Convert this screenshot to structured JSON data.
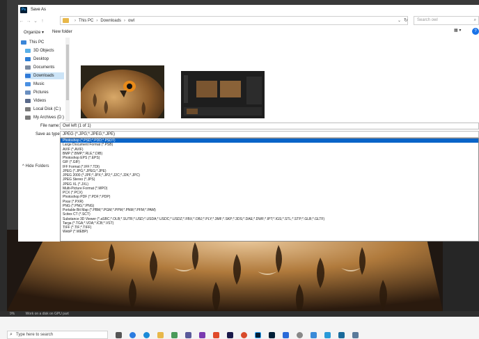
{
  "dialog": {
    "title": "Save As",
    "app_icon_text": "Ps",
    "breadcrumb": [
      "This PC",
      "Downloads",
      "owl"
    ],
    "search_placeholder": "Search owl",
    "toolbar": {
      "organize": "Organize ▾",
      "new_folder": "New folder"
    },
    "nav_items": [
      {
        "label": "This PC",
        "color": "#3a86d8"
      },
      {
        "label": "3D Objects",
        "color": "#5ab0e8"
      },
      {
        "label": "Desktop",
        "color": "#2d7ed6"
      },
      {
        "label": "Documents",
        "color": "#7a8aa0"
      },
      {
        "label": "Downloads",
        "color": "#2f7ad8",
        "active": true
      },
      {
        "label": "Music",
        "color": "#4a90e2"
      },
      {
        "label": "Pictures",
        "color": "#6a8fc0"
      },
      {
        "label": "Videos",
        "color": "#5a6a8a"
      },
      {
        "label": "Local Disk (C:)",
        "color": "#7a7a7a"
      },
      {
        "label": "My Archives (D:)",
        "color": "#7a7a7a"
      }
    ],
    "filename_label": "File name:",
    "filename_value": "Owl left (1 of 1)",
    "savetype_label": "Save as type:",
    "savetype_value": "JPEG (*.JPG;*.JPEG;*.JPE)",
    "hide_folders": "Hide Folders",
    "formats": [
      "Photoshop (*.PSD;*.PDD;*.PSDT)",
      "Large Document Format (*.PSB)",
      "AVIF (*.AVIF)",
      "BMP (*.BMP;*.RLE;*.DIB)",
      "Photoshop EPS (*.EPS)",
      "GIF (*.GIF)",
      "IFF Format (*.IFF;*.TDI)",
      "JPEG (*.JPG;*.JPEG;*.JPE)",
      "JPEG 2000 (*.JPF;*.JPX;*.JP2;*.J2C;*.J2K;*.JPC)",
      "JPEG Stereo (*.JPS)",
      "JPEG XL (*.JXL)",
      "Multi-Picture Format (*.MPO)",
      "PCX (*.PCX)",
      "Photoshop PDF (*.PDF;*.PDP)",
      "Pixar (*.PXR)",
      "PNG (*.PNG;*.PNG)",
      "Portable Bit Map (*.PBM;*.PGM;*.PPM;*.PNM;*.PFM;*.PAM)",
      "Scitex CT (*.SCT)",
      "Substance 3D Viewer (*.aSBC;*.OLB;*.SUTR;*.USD;*.USDA;*.USDC;*.USDZ;*.FBX;*.OBJ;*.PLY;*.3MF;*.SKP;*.3DS;*.DAE;*.DWF;*.IPT;*.IGS;*.STL;*.STP;*.GLB;*.GLTF)",
      "Targa (*.TGA;*.VDA;*.ICB;*.VST)",
      "TIFF (*.TIF;*.TIFF)",
      "WebP (*.WEBP)"
    ],
    "selected_format_index": 0
  },
  "status_bar": {
    "zoom": "9%",
    "doc_info": "Work on a disk on GPU part"
  },
  "taskbar": {
    "search_placeholder": "Type here to search"
  }
}
